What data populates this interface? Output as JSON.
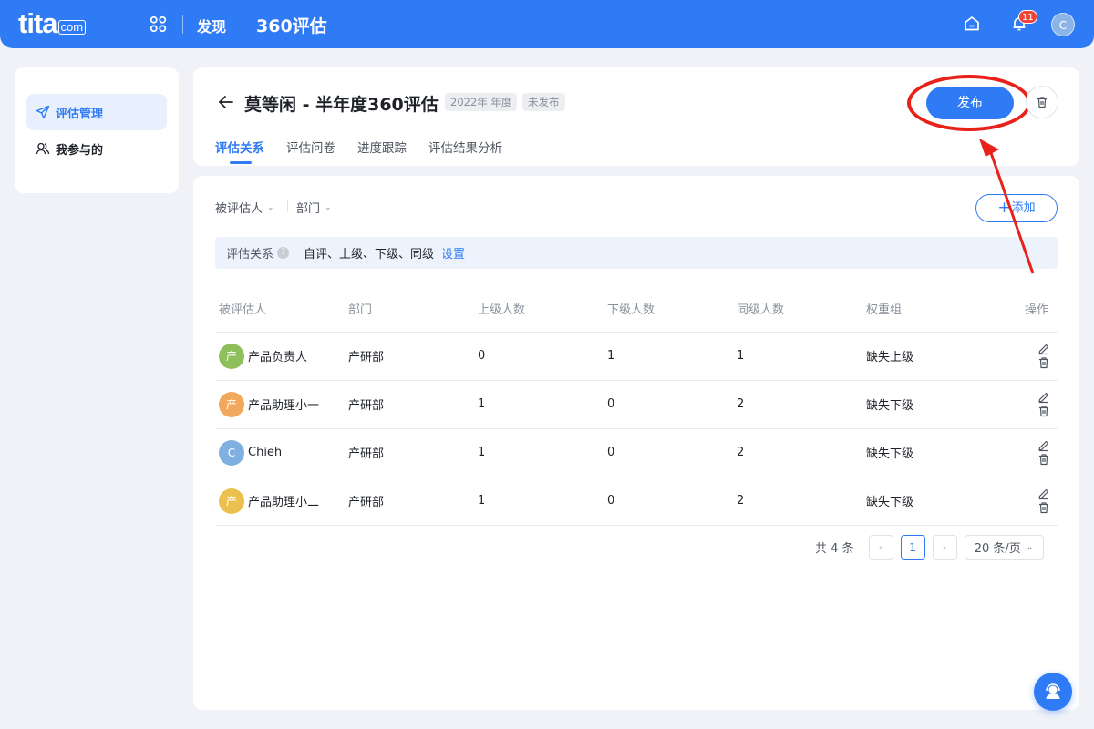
{
  "topbar": {
    "logo_main": "tita",
    "logo_suffix": "com",
    "nav_discover": "发现",
    "nav_current": "360评估",
    "notification_count": "11",
    "user_initial": "C"
  },
  "sidebar": {
    "items": [
      {
        "label": "评估管理",
        "icon": "send-icon",
        "active": true
      },
      {
        "label": "我参与的",
        "icon": "people-icon",
        "active": false
      }
    ]
  },
  "header": {
    "title": "莫等闲 - 半年度360评估",
    "tag_year": "2022年 年度",
    "tag_status": "未发布",
    "publish_label": "发布",
    "tabs": [
      "评估关系",
      "评估问卷",
      "进度跟踪",
      "评估结果分析"
    ]
  },
  "filters": {
    "evaluatee": "被评估人",
    "department": "部门",
    "add_label": "添加"
  },
  "relation_bar": {
    "label": "评估关系",
    "value": "自评、上级、下级、同级",
    "link": "设置"
  },
  "table": {
    "headers": [
      "被评估人",
      "部门",
      "上级人数",
      "下级人数",
      "同级人数",
      "权重组",
      "操作"
    ],
    "rows": [
      {
        "avatar": "产",
        "avatar_color": "#8fbf5a",
        "name": "产品负责人",
        "dept": "产研部",
        "superiors": "0",
        "subordinates": "1",
        "peers": "1",
        "weight": "缺失上级"
      },
      {
        "avatar": "产",
        "avatar_color": "#f2a85c",
        "name": "产品助理小一",
        "dept": "产研部",
        "superiors": "1",
        "subordinates": "0",
        "peers": "2",
        "weight": "缺失下级"
      },
      {
        "avatar": "C",
        "avatar_color": "#7fb0e0",
        "name": "Chieh",
        "dept": "产研部",
        "superiors": "1",
        "subordinates": "0",
        "peers": "2",
        "weight": "缺失下级"
      },
      {
        "avatar": "产",
        "avatar_color": "#ecc04e",
        "name": "产品助理小二",
        "dept": "产研部",
        "superiors": "1",
        "subordinates": "0",
        "peers": "2",
        "weight": "缺失下级"
      }
    ]
  },
  "pagination": {
    "total": "共 4 条",
    "current_page": "1",
    "page_size": "20 条/页"
  },
  "colors": {
    "accent": "#2f7bf5",
    "annotation": "#e8211a"
  }
}
